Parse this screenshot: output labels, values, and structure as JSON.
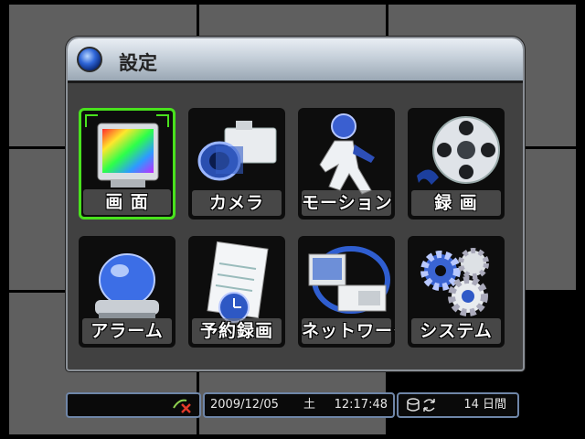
{
  "dialog": {
    "title": "設定"
  },
  "menu": {
    "items": [
      {
        "label": "画 面",
        "icon": "monitor-icon",
        "selected": true
      },
      {
        "label": "カメラ",
        "icon": "camera-icon",
        "selected": false
      },
      {
        "label": "モーション",
        "icon": "motion-figure-icon",
        "selected": false
      },
      {
        "label": "録 画",
        "icon": "film-reel-icon",
        "selected": false
      },
      {
        "label": "アラーム",
        "icon": "alarm-light-icon",
        "selected": false
      },
      {
        "label": "予約録画",
        "icon": "schedule-notepad-icon",
        "selected": false
      },
      {
        "label": "ネットワーク",
        "icon": "network-pc-icon",
        "selected": false
      },
      {
        "label": "システム",
        "icon": "gears-icon",
        "selected": false
      }
    ]
  },
  "status": {
    "date": "2009/12/05",
    "day": "土",
    "time": "12:17:48",
    "remaining": "14 日間",
    "audio_icon": "audio-muted-icon",
    "hdd_icon": "hdd-cycle-icon"
  },
  "colors": {
    "selection": "#49e21d",
    "status_border": "#6f86a8"
  }
}
